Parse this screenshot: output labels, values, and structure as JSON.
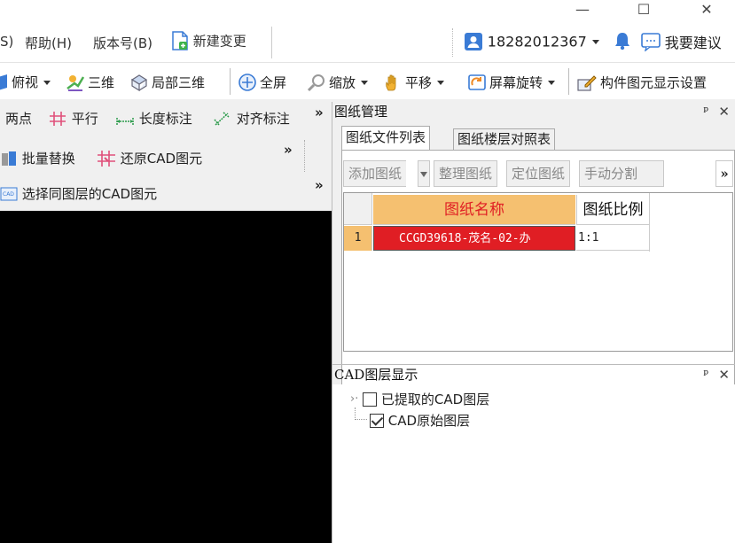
{
  "window": {
    "controls": [
      "—",
      "☐",
      "✕"
    ]
  },
  "menu": {
    "partial": "S)",
    "help": "帮助(H)",
    "version": "版本号(B)",
    "new_change": "新建变更",
    "phone": "18282012367",
    "suggest": "我要建议"
  },
  "toolbar": {
    "top_view": "俯视",
    "three_d": "三维",
    "local_3d": "局部三维",
    "full_screen": "全屏",
    "zoom": "缩放",
    "pan": "平移",
    "rotate": "屏幕旋转",
    "component_display": "构件图元显示设置"
  },
  "left_panel": {
    "row1": {
      "two_points": "两点",
      "parallel": "平行",
      "length_dim": "长度标注",
      "align_dim": "对齐标注",
      "more": "»"
    },
    "row2": {
      "batch_replace": "批量替换",
      "restore_cad": "还原CAD图元",
      "more": "»"
    },
    "row3": {
      "select_same_layer": "选择同图层的CAD图元",
      "more": "»"
    }
  },
  "drawing_panel": {
    "title": "图纸管理",
    "tabs": [
      "图纸文件列表",
      "图纸楼层对照表"
    ],
    "buttons": {
      "add": "添加图纸",
      "organize": "整理图纸",
      "locate": "定位图纸",
      "manual_split": "手动分割",
      "more": "»"
    },
    "table": {
      "headers": [
        "图纸名称",
        "图纸比例"
      ],
      "rows": [
        {
          "index": "1",
          "name": "CCGD39618-茂名-02-办",
          "scale": "1:1"
        }
      ]
    }
  },
  "layer_panel": {
    "title": "CAD图层显示",
    "items": [
      {
        "label": "已提取的CAD图层",
        "checked": false
      },
      {
        "label": "CAD原始图层",
        "checked": true
      }
    ]
  },
  "colors": {
    "header_orange": "#f5c070",
    "selected_red": "#e01e24",
    "accent_blue": "#3a7bd5"
  }
}
